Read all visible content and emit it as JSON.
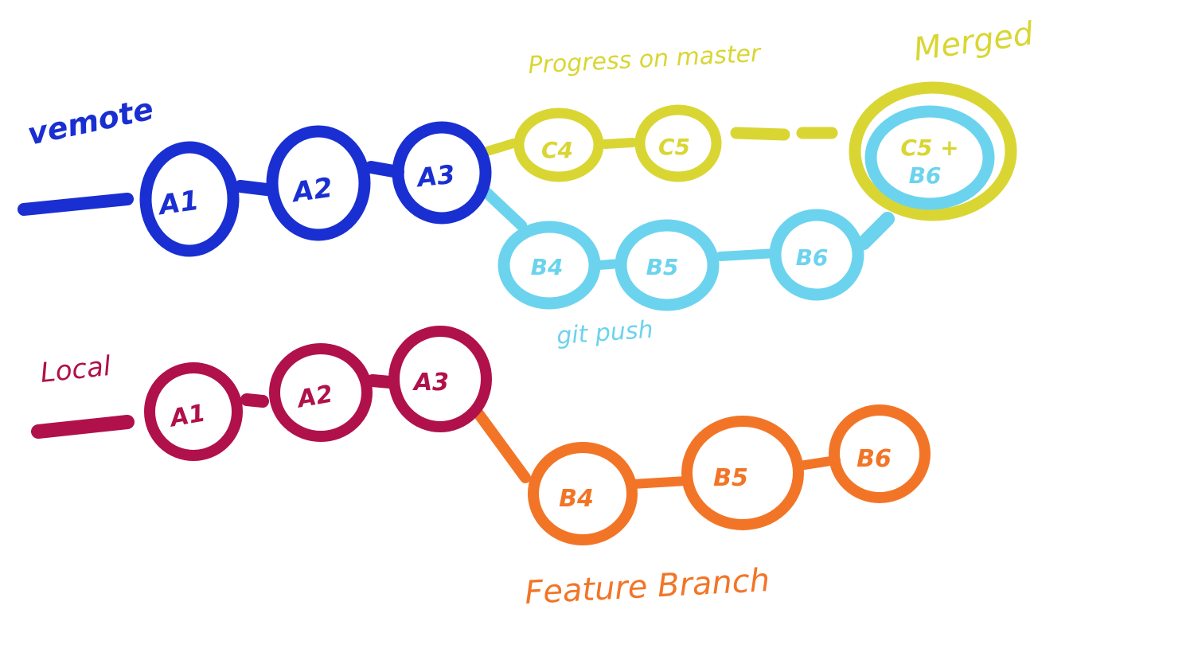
{
  "colors": {
    "remote_blue": "#1a2fd1",
    "yellow": "#d9d634",
    "light_blue": "#6cd3ee",
    "local_red": "#b0114a",
    "orange": "#f27527"
  },
  "labels": {
    "remote": "vemote",
    "local": "Local",
    "progress": "Progress on master",
    "merged": "Merged",
    "git_push": "git push",
    "feature_branch": "Feature Branch"
  },
  "nodes": {
    "remote_a1": "A1",
    "remote_a2": "A2",
    "remote_a3": "A3",
    "c4": "C4",
    "c5": "C5",
    "merge_line1": "C5 +",
    "merge_line2": "B6",
    "remote_b4": "B4",
    "remote_b5": "B5",
    "remote_b6": "B6",
    "local_a1": "A1",
    "local_a2": "A2",
    "local_a3": "A3",
    "local_b4": "B4",
    "local_b5": "B5",
    "local_b6": "B6"
  }
}
